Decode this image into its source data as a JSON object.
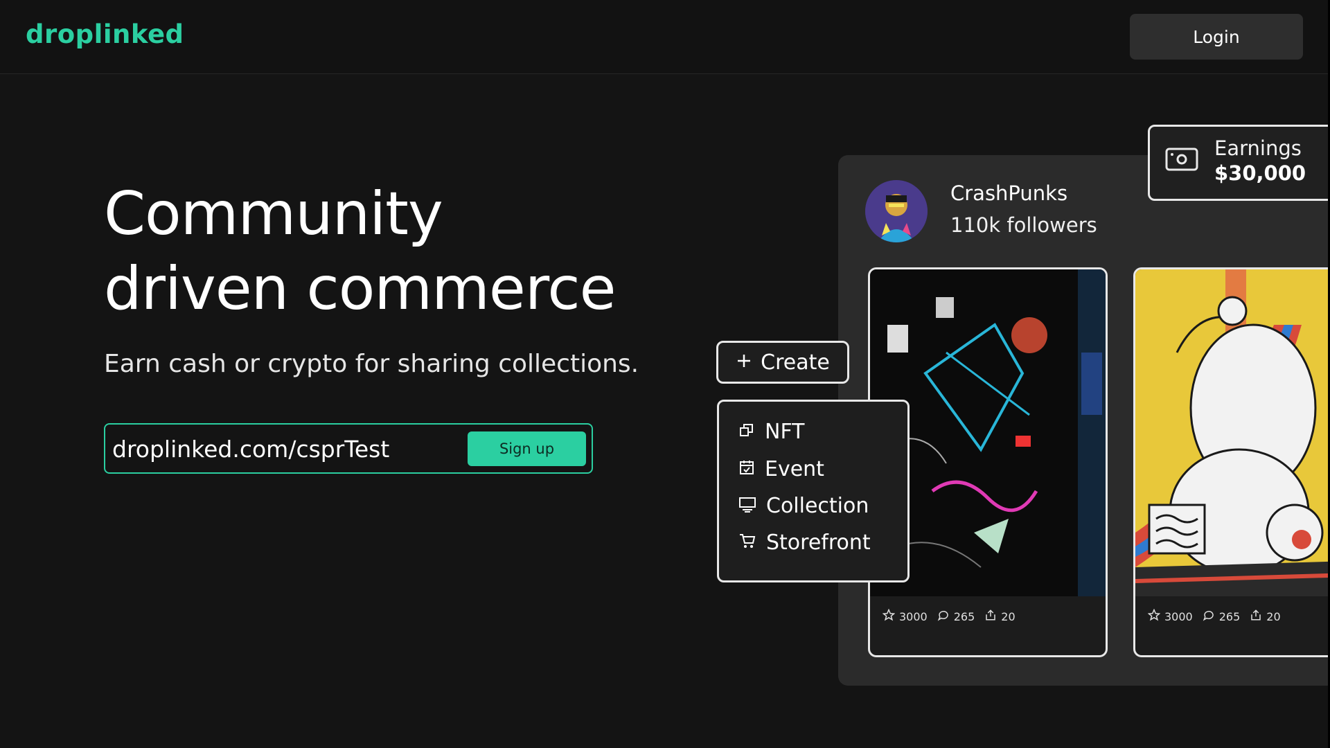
{
  "header": {
    "logo": "droplinked",
    "login_label": "Login"
  },
  "hero": {
    "title_line1": "Community",
    "title_line2": "driven commerce",
    "subtitle": "Earn cash or crypto for sharing collections.",
    "signup_value": "droplinked.com/csprTest",
    "signup_button": "Sign up"
  },
  "mockup": {
    "profile": {
      "name": "CrashPunks",
      "followers": "110k followers"
    },
    "earnings": {
      "label": "Earnings",
      "value": "$30,000"
    },
    "create_label": "Create",
    "create_menu": [
      {
        "label": "NFT",
        "icon": "copy-icon"
      },
      {
        "label": "Event",
        "icon": "calendar-check-icon"
      },
      {
        "label": "Collection",
        "icon": "monitor-icon"
      },
      {
        "label": "Storefront",
        "icon": "cart-icon"
      }
    ],
    "cards": [
      {
        "likes": "3000",
        "comments": "265",
        "shares": "20"
      },
      {
        "likes": "3000",
        "comments": "265",
        "shares": "20"
      }
    ]
  },
  "colors": {
    "accent": "#2bcfa1",
    "background": "#141414",
    "panel": "#2b2b2b"
  }
}
